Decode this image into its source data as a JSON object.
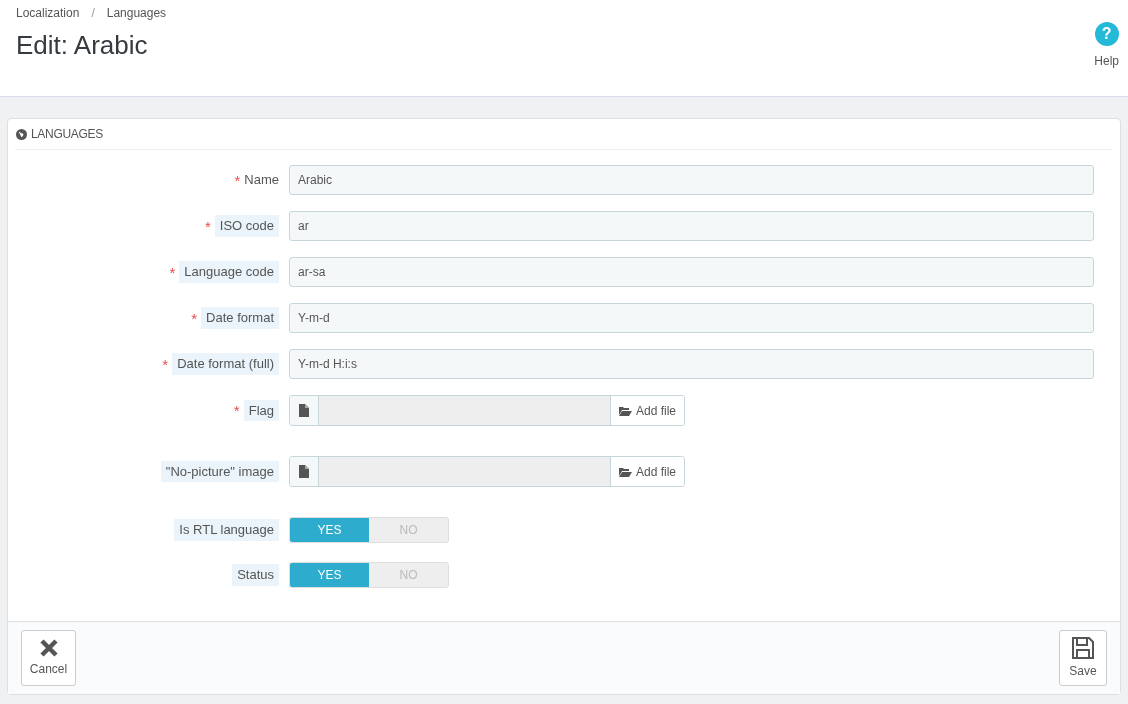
{
  "breadcrumb": {
    "items": [
      "Localization",
      "Languages"
    ],
    "separator": "/"
  },
  "title": "Edit: Arabic",
  "help": {
    "icon": "?",
    "label": "Help"
  },
  "panel": {
    "heading": "LANGUAGES",
    "fields": [
      {
        "kind": "text",
        "label": "Name",
        "asterisk": "*",
        "hint": false,
        "value": "Arabic"
      },
      {
        "kind": "text",
        "label": "ISO code",
        "asterisk": "*",
        "hint": true,
        "value": "ar"
      },
      {
        "kind": "text",
        "label": "Language code",
        "asterisk": "*",
        "hint": true,
        "value": "ar-sa"
      },
      {
        "kind": "text",
        "label": "Date format",
        "asterisk": "*",
        "hint": true,
        "value": "Y-m-d"
      },
      {
        "kind": "text",
        "label": "Date format (full)",
        "asterisk": "*",
        "hint": true,
        "value": "Y-m-d H:i:s"
      },
      {
        "kind": "file",
        "label": "Flag",
        "asterisk": "*",
        "hint": true,
        "button": "Add file"
      },
      {
        "kind": "file",
        "label": "\"No-picture\" image",
        "hint": true,
        "button": "Add file"
      },
      {
        "kind": "switch",
        "label": "Is RTL language",
        "hint": true,
        "options": [
          {
            "label": "YES",
            "selected": true
          },
          {
            "label": "NO",
            "selected": false
          }
        ]
      },
      {
        "kind": "switch",
        "label": "Status",
        "hint": true,
        "options": [
          {
            "label": "YES",
            "selected": true
          },
          {
            "label": "NO",
            "selected": false
          }
        ]
      }
    ],
    "cancel": "Cancel",
    "save": "Save"
  }
}
